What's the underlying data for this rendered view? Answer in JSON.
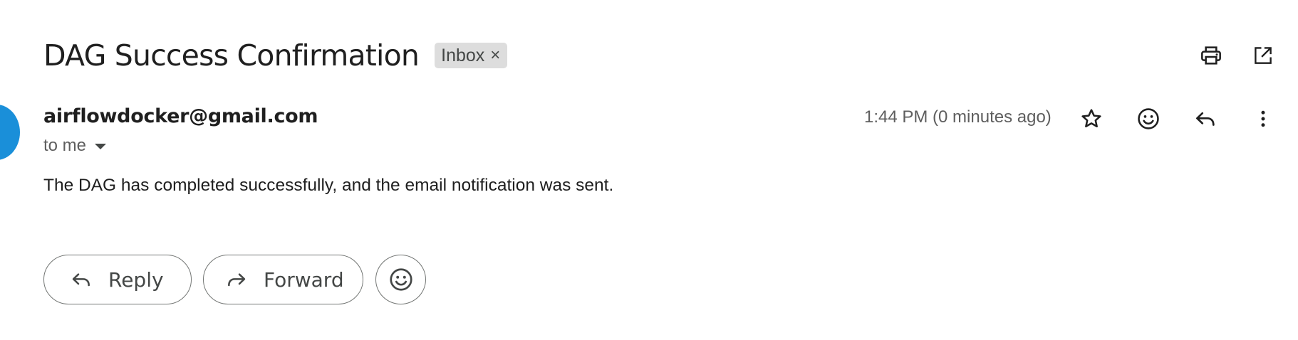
{
  "email": {
    "subject": "DAG Success Confirmation",
    "label": "Inbox",
    "label_remove": "×",
    "sender": "airflowdocker@gmail.com",
    "recipient": "to me",
    "timestamp": "1:44 PM (0 minutes ago)",
    "body": "The DAG has completed successfully, and the email notification was sent."
  },
  "top_actions": {
    "print_icon": "printer-icon",
    "open_icon": "open-in-new-window-icon"
  },
  "message_actions": {
    "star_icon": "star-outline-icon",
    "emoji_icon": "emoji-reaction-icon",
    "reply_icon": "reply-arrow-icon",
    "more_icon": "more-vertical-icon"
  },
  "footer_actions": {
    "reply_label": "Reply",
    "forward_label": "Forward",
    "emoji_icon": "emoji-reaction-icon"
  },
  "colors": {
    "avatar": "#1a8fd9",
    "label_chip": "#dddddd",
    "text_primary": "#1f1f1f",
    "text_secondary": "#5e5e5e",
    "icon": "#444746",
    "pill_border": "#747775"
  }
}
